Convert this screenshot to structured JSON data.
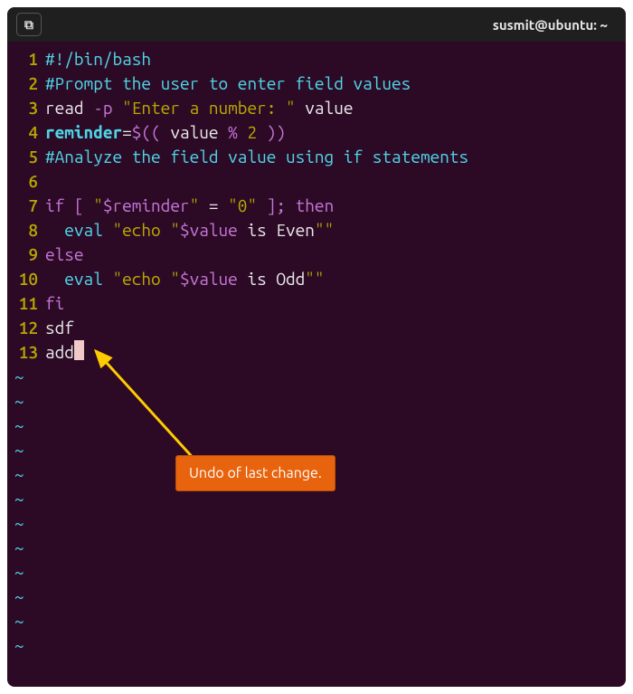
{
  "titlebar": {
    "title": "susmit@ubuntu: ~",
    "newtab_icon": "⧉"
  },
  "lines": [
    {
      "n": "1",
      "seg": [
        {
          "t": "#!/bin/bash",
          "c": "c-cyan"
        }
      ]
    },
    {
      "n": "2",
      "seg": [
        {
          "t": "#Prompt the user to enter field values",
          "c": "c-cyan"
        }
      ]
    },
    {
      "n": "3",
      "seg": [
        {
          "t": "read ",
          "c": "c-white"
        },
        {
          "t": "-p ",
          "c": "c-mag"
        },
        {
          "t": "\"Enter a number: \"",
          "c": "c-str"
        },
        {
          "t": " value",
          "c": "c-white"
        }
      ]
    },
    {
      "n": "4",
      "seg": [
        {
          "t": "reminder",
          "c": "c-cyan c-bold"
        },
        {
          "t": "=",
          "c": "c-white"
        },
        {
          "t": "$(( ",
          "c": "c-mag"
        },
        {
          "t": "value ",
          "c": "c-white"
        },
        {
          "t": "% ",
          "c": "c-mag"
        },
        {
          "t": "2 ",
          "c": "c-str"
        },
        {
          "t": "))",
          "c": "c-mag"
        }
      ]
    },
    {
      "n": "5",
      "seg": [
        {
          "t": "#Analyze the field value using if statements",
          "c": "c-cyan"
        }
      ]
    },
    {
      "n": "6",
      "seg": []
    },
    {
      "n": "7",
      "seg": [
        {
          "t": "if [ ",
          "c": "c-mag"
        },
        {
          "t": "\"",
          "c": "c-str"
        },
        {
          "t": "$reminder",
          "c": "c-mag"
        },
        {
          "t": "\"",
          "c": "c-str"
        },
        {
          "t": " = ",
          "c": "c-white"
        },
        {
          "t": "\"0\"",
          "c": "c-str"
        },
        {
          "t": " ]; then",
          "c": "c-mag"
        }
      ]
    },
    {
      "n": "8",
      "seg": [
        {
          "t": "  ",
          "c": ""
        },
        {
          "t": "eval ",
          "c": "c-cyan"
        },
        {
          "t": "\"echo \"",
          "c": "c-str"
        },
        {
          "t": "$value",
          "c": "c-mag"
        },
        {
          "t": " is Even",
          "c": "c-white"
        },
        {
          "t": "\"\"",
          "c": "c-str"
        }
      ]
    },
    {
      "n": "9",
      "seg": [
        {
          "t": "else",
          "c": "c-mag"
        }
      ]
    },
    {
      "n": "10",
      "seg": [
        {
          "t": "  ",
          "c": ""
        },
        {
          "t": "eval ",
          "c": "c-cyan"
        },
        {
          "t": "\"echo \"",
          "c": "c-str"
        },
        {
          "t": "$value",
          "c": "c-mag"
        },
        {
          "t": " is Odd",
          "c": "c-white"
        },
        {
          "t": "\"\"",
          "c": "c-str"
        }
      ]
    },
    {
      "n": "11",
      "seg": [
        {
          "t": "fi",
          "c": "c-mag"
        }
      ]
    },
    {
      "n": "12",
      "seg": [
        {
          "t": "sdf",
          "c": "c-white"
        }
      ]
    },
    {
      "n": "13",
      "seg": [
        {
          "t": "add",
          "c": "c-white"
        }
      ],
      "cursor": true
    }
  ],
  "tilde_count": 12,
  "tilde": "~",
  "annotation": {
    "text": "Undo of last change."
  }
}
